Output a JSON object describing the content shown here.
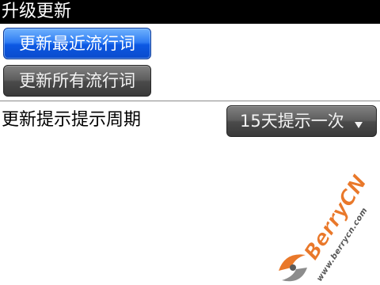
{
  "title_bar": {
    "title": "升级更新"
  },
  "buttons": {
    "update_recent": "更新最近流行词",
    "update_all": "更新所有流行词"
  },
  "reminder": {
    "label": "更新提示提示周期",
    "selected": "15天提示一次",
    "arrow_icon": "dropdown-arrow-icon"
  },
  "watermark": {
    "brand": "BerryCN",
    "url": "www.berrycn.com",
    "logo_icon": "berrycn-logo-icon"
  },
  "colors": {
    "title_bar_bg": "#000000",
    "focused_button": "#0c58e3",
    "button_gray": "#4a4a4a",
    "watermark_orange": "#e9782a"
  }
}
